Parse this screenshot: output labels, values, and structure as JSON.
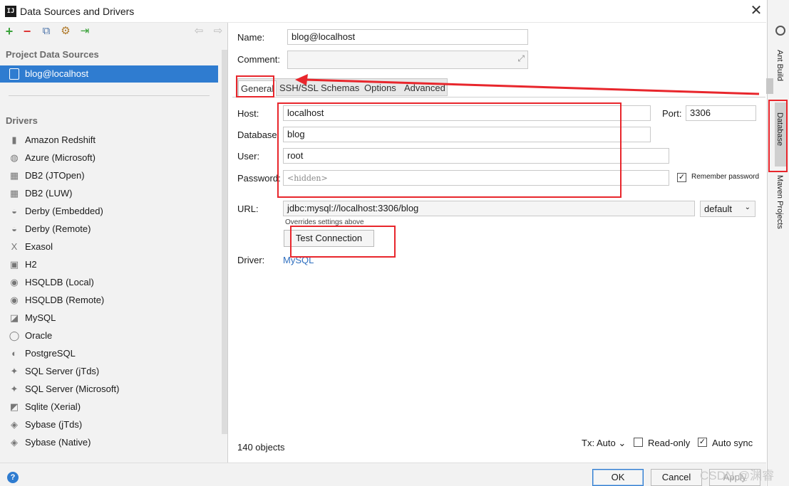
{
  "window": {
    "title": "Data Sources and Drivers",
    "app_icon": "IJ",
    "close": "✕"
  },
  "toolbar": {
    "add": "+",
    "remove": "−",
    "copy": "⧉",
    "config": "⚙",
    "import": "⇥",
    "back": "⇦",
    "forward": "⇨"
  },
  "left": {
    "section_project": "Project Data Sources",
    "datasource": "blog@localhost",
    "section_drivers": "Drivers",
    "drivers": [
      {
        "label": "Amazon Redshift",
        "icon": "▮"
      },
      {
        "label": "Azure (Microsoft)",
        "icon": "◍"
      },
      {
        "label": "DB2 (JTOpen)",
        "icon": "▦"
      },
      {
        "label": "DB2 (LUW)",
        "icon": "▦"
      },
      {
        "label": "Derby (Embedded)",
        "icon": "◒"
      },
      {
        "label": "Derby (Remote)",
        "icon": "◒"
      },
      {
        "label": "Exasol",
        "icon": "X"
      },
      {
        "label": "H2",
        "icon": "▣"
      },
      {
        "label": "HSQLDB (Local)",
        "icon": "◉"
      },
      {
        "label": "HSQLDB (Remote)",
        "icon": "◉"
      },
      {
        "label": "MySQL",
        "icon": "◪"
      },
      {
        "label": "Oracle",
        "icon": "◯"
      },
      {
        "label": "PostgreSQL",
        "icon": "◐"
      },
      {
        "label": "SQL Server (jTds)",
        "icon": "✦"
      },
      {
        "label": "SQL Server (Microsoft)",
        "icon": "✦"
      },
      {
        "label": "Sqlite (Xerial)",
        "icon": "◩"
      },
      {
        "label": "Sybase (jTds)",
        "icon": "◈"
      },
      {
        "label": "Sybase (Native)",
        "icon": "◈"
      }
    ]
  },
  "form": {
    "name_label": "Name:",
    "name_value": "blog@localhost",
    "comment_label": "Comment:",
    "comment_value": "",
    "tabs": [
      "General",
      "SSH/SSL",
      "Schemas",
      "Options",
      "Advanced"
    ],
    "host_label": "Host:",
    "host_value": "localhost",
    "port_label": "Port:",
    "port_value": "3306",
    "database_label": "Database:",
    "database_value": "blog",
    "user_label": "User:",
    "user_value": "root",
    "password_label": "Password:",
    "password_placeholder": "<hidden>",
    "remember_password": "Remember password",
    "url_label": "URL:",
    "url_value": "jdbc:mysql://localhost:3306/blog",
    "url_mode": "default",
    "overrides_note": "Overrides settings above",
    "test_connection": "Test Connection",
    "driver_label": "Driver:",
    "driver_value": "MySQL"
  },
  "status": {
    "objects": "140 objects",
    "tx": "Tx: Auto",
    "read_only": "Read-only",
    "auto_sync": "Auto sync"
  },
  "buttons": {
    "ok": "OK",
    "cancel": "Cancel",
    "apply": "Apply",
    "help": "?"
  },
  "side_tools": {
    "ant": "Ant Build",
    "database": "Database",
    "maven": "Maven Projects"
  },
  "watermark": "CSDN @渊睿"
}
